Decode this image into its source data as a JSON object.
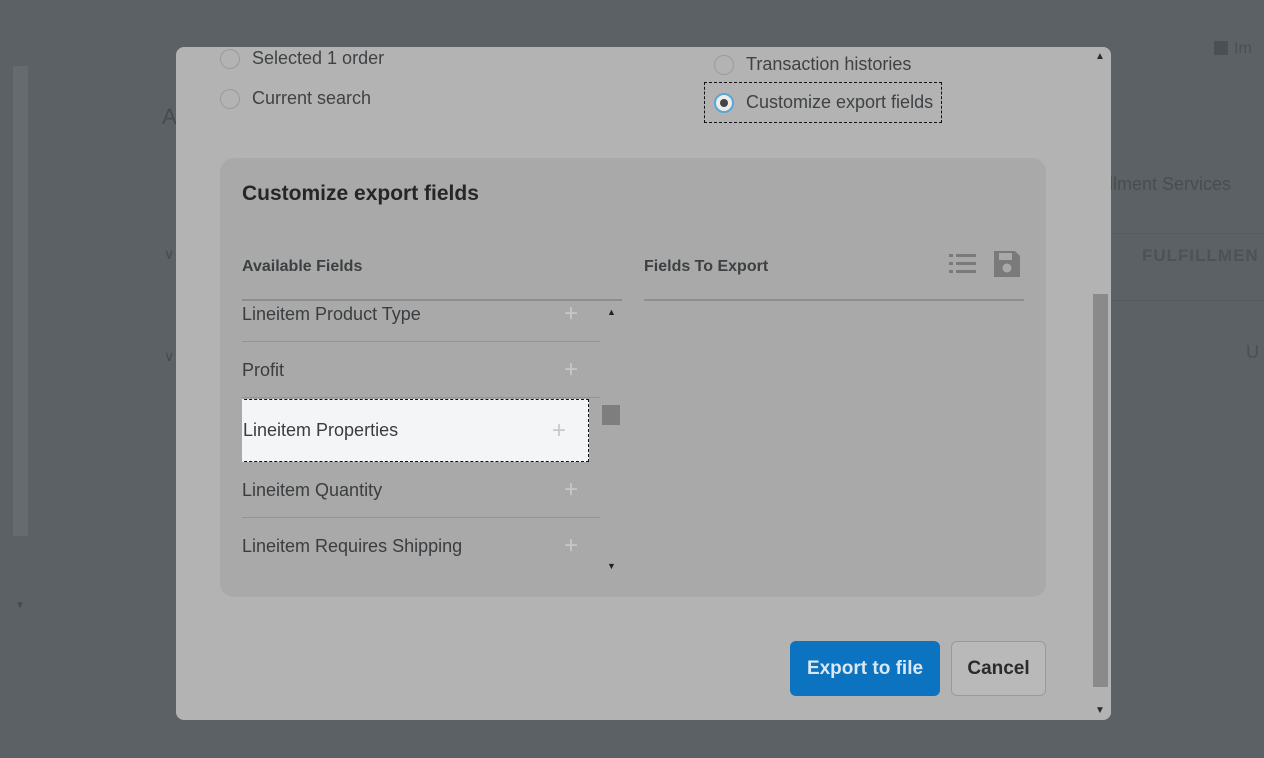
{
  "background": {
    "fulfillment_services": "illment Services",
    "fulfillment_caps": "FULFILLMEN",
    "import_label": "Im",
    "us_label": "U",
    "partial_letter": "A"
  },
  "modal": {
    "scope_options": [
      {
        "label": "Selected 1 order",
        "checked": false
      },
      {
        "label": "Current search",
        "checked": false
      }
    ],
    "type_options": [
      {
        "label": "Transaction histories",
        "checked": false
      },
      {
        "label": "Customize export fields",
        "checked": true
      }
    ],
    "panel": {
      "title": "Customize export fields",
      "available_header": "Available Fields",
      "export_header": "Fields To Export",
      "available_fields": [
        "Lineitem Product Type",
        "Profit",
        "Lineitem Properties",
        "Lineitem Quantity",
        "Lineitem Requires Shipping"
      ],
      "highlighted_field": "Lineitem Properties",
      "fields_to_export": []
    },
    "buttons": {
      "export": "Export to file",
      "cancel": "Cancel"
    }
  },
  "colors": {
    "primary": "#0b73c0",
    "overlay": "#5b6164",
    "modal_bg": "#b3b3b3",
    "panel_bg": "#a9a9a9"
  }
}
